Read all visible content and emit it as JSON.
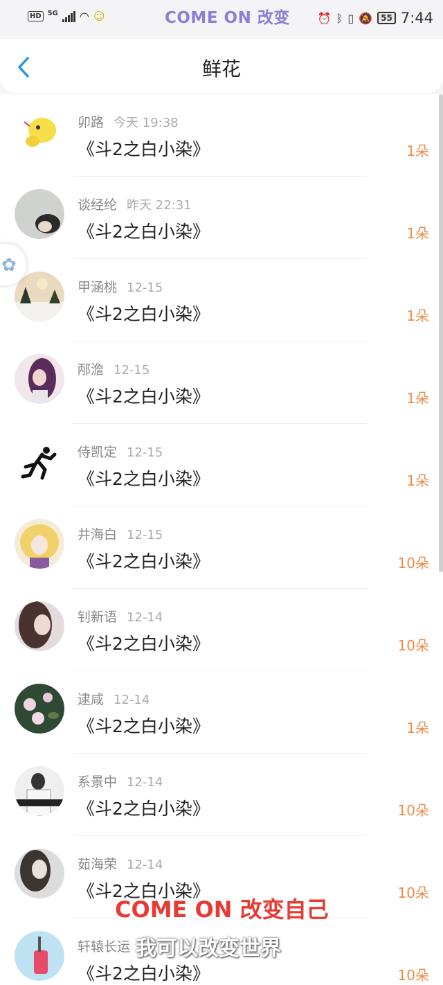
{
  "status_bar": {
    "hd": "HD",
    "network": "5G",
    "overlay_title": "COME ON 改变",
    "battery": "55",
    "time": "7:44"
  },
  "nav": {
    "title": "鲜花",
    "back_icon": "chevron-left-icon"
  },
  "rows": [
    {
      "name": "卯路",
      "date": "今天 19:38",
      "book": "《斗2之白小染》",
      "count": "1朵"
    },
    {
      "name": "谈经纶",
      "date": "昨天 22:31",
      "book": "《斗2之白小染》",
      "count": "1朵"
    },
    {
      "name": "甲涵桃",
      "date": "12-15",
      "book": "《斗2之白小染》",
      "count": "1朵"
    },
    {
      "name": "邴澹",
      "date": "12-15",
      "book": "《斗2之白小染》",
      "count": "1朵"
    },
    {
      "name": "侍凯定",
      "date": "12-15",
      "book": "《斗2之白小染》",
      "count": "1朵"
    },
    {
      "name": "井海白",
      "date": "12-15",
      "book": "《斗2之白小染》",
      "count": "10朵"
    },
    {
      "name": "钊新语",
      "date": "12-14",
      "book": "《斗2之白小染》",
      "count": "10朵"
    },
    {
      "name": "逮咸",
      "date": "12-14",
      "book": "《斗2之白小染》",
      "count": "1朵"
    },
    {
      "name": "系景中",
      "date": "12-14",
      "book": "《斗2之白小染》",
      "count": "10朵"
    },
    {
      "name": "茹海荣",
      "date": "12-14",
      "book": "《斗2之白小染》",
      "count": "10朵"
    },
    {
      "name": "轩辕长运",
      "date": "",
      "book": "《斗2之白小染》",
      "count": "10朵"
    }
  ],
  "captions": {
    "red": "COME ON 改变自己",
    "white": "我可以改变世界"
  },
  "colors": {
    "accent": "#2e8fe0",
    "count": "#f08a46",
    "caption_red": "#e63b35"
  }
}
